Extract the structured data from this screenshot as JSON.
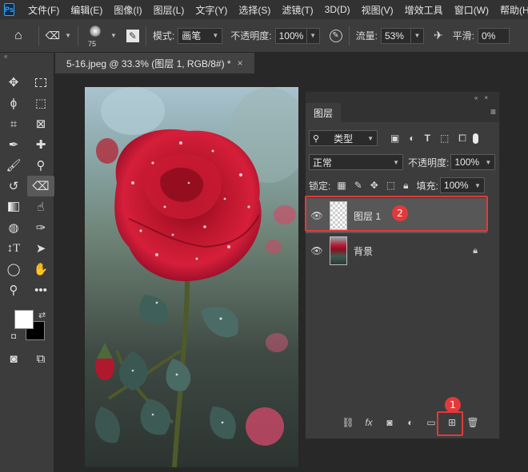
{
  "app": {
    "logo": "Ps"
  },
  "menu": [
    "文件(F)",
    "编辑(E)",
    "图像(I)",
    "图层(L)",
    "文字(Y)",
    "选择(S)",
    "滤镜(T)",
    "3D(D)",
    "视图(V)",
    "增效工具",
    "窗口(W)",
    "帮助(H)"
  ],
  "options": {
    "brush_size": "75",
    "mode_label": "模式:",
    "mode_value": "画笔",
    "opacity_label": "不透明度:",
    "opacity_value": "100%",
    "flow_label": "流量:",
    "flow_value": "53%",
    "smooth_label": "平滑:",
    "smooth_value": "0%"
  },
  "document": {
    "tab_title": "5-16.jpeg @ 33.3% (图层 1, RGB/8#) *",
    "close": "×"
  },
  "layers_panel": {
    "tab": "图层",
    "filter_label": "类型",
    "blend_mode": "正常",
    "opacity_label": "不透明度:",
    "opacity_value": "100%",
    "lock_label": "锁定:",
    "fill_label": "填充:",
    "fill_value": "100%",
    "layers": [
      {
        "name": "图层 1",
        "selected": true
      },
      {
        "name": "背景",
        "locked": true
      }
    ]
  },
  "annotations": {
    "badge_1": "1",
    "badge_2": "2",
    "color": "#e23a3a"
  }
}
